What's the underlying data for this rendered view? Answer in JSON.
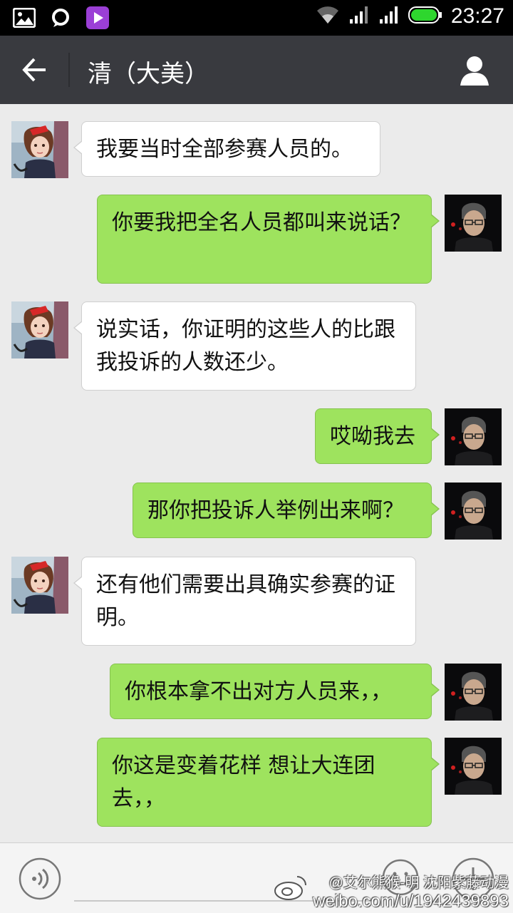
{
  "status_bar": {
    "time": "23:27",
    "left_icons": [
      "gallery-icon",
      "chat-bubble-icon",
      "video-player-icon"
    ],
    "right_icons": [
      "wifi-icon",
      "signal-icon",
      "signal-icon",
      "battery-icon"
    ]
  },
  "header": {
    "title": "清（大美）",
    "back_icon": "arrow-left-icon",
    "profile_icon": "person-icon"
  },
  "messages": [
    {
      "side": "in",
      "text": "我要当时全部参赛人员的。"
    },
    {
      "side": "out",
      "text": "你要我把全名人员都叫来说话？"
    },
    {
      "side": "in",
      "text": "说实话，你证明的这些人的比跟我投诉的人数还少。"
    },
    {
      "side": "out",
      "text": "哎呦我去"
    },
    {
      "side": "out",
      "text": "那你把投诉人举例出来啊？"
    },
    {
      "side": "in",
      "text": "还有他们需要出具确实参赛的证明。"
    },
    {
      "side": "out",
      "text": "你根本拿不出对方人员来，，"
    },
    {
      "side": "out",
      "text": "你这是变着花样 想让大连团去，，"
    }
  ],
  "input_bar": {
    "placeholder": "",
    "voice_icon": "voice-icon",
    "emoji_icon": "emoji-icon",
    "plus_icon": "plus-icon"
  },
  "watermark": {
    "line1": "@艾尔熊猴-明 沈阳紫藤动漫",
    "line2": "weibo.com/u/1942439893"
  }
}
